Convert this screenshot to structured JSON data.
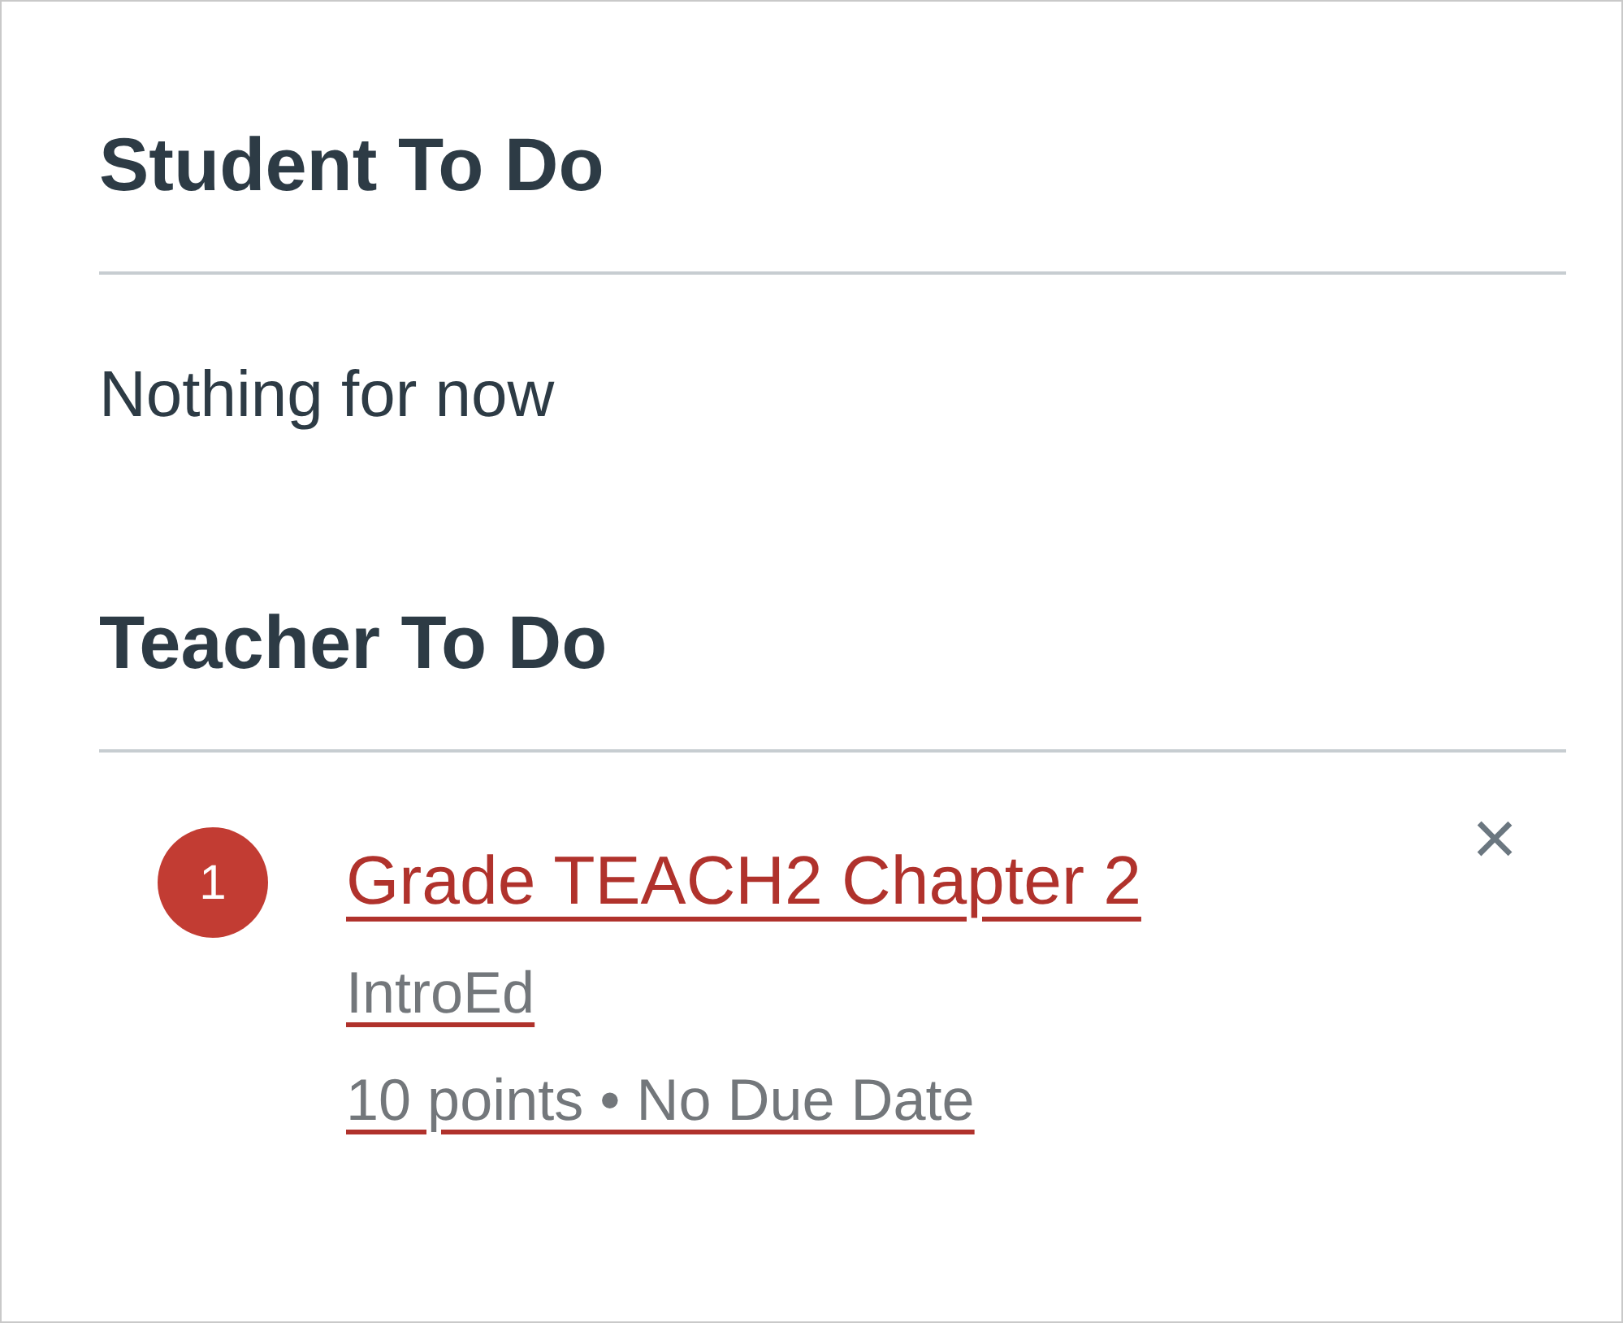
{
  "sections": [
    {
      "title": "Student To Do",
      "empty_text": "Nothing for now"
    },
    {
      "title": "Teacher To Do",
      "items": [
        {
          "count": "1",
          "title": "Grade TEACH2 Chapter 2",
          "course": "IntroEd",
          "details": "10 points • No Due Date",
          "dismiss": "×"
        }
      ]
    }
  ]
}
